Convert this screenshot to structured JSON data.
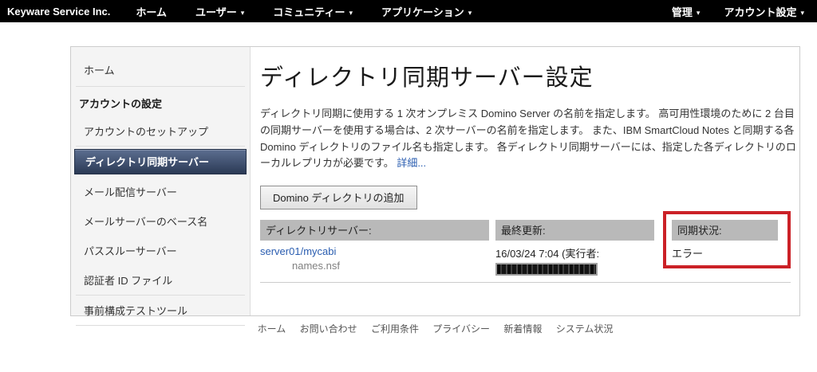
{
  "icons": {
    "caret": "▾"
  },
  "colors": {
    "topbar_bg": "#000000",
    "selected_gradient_top": "#5c6e90",
    "selected_gradient_bottom": "#2b3a55",
    "table_header_gray": "#b9b9b9",
    "link_blue": "#2a5db0",
    "highlight_red": "#cb2127"
  },
  "topbar": {
    "brand": "Keyware Service Inc.",
    "items": [
      {
        "label": "ホーム"
      },
      {
        "label": "ユーザー"
      },
      {
        "label": "コミュニティー"
      },
      {
        "label": "アプリケーション"
      }
    ],
    "right_items": [
      {
        "label": "管理"
      },
      {
        "label": "アカウント設定"
      }
    ]
  },
  "sidebar": {
    "home_label": "ホーム",
    "section_label": "アカウントの設定",
    "items": [
      {
        "label": "アカウントのセットアップ",
        "selected": false
      },
      {
        "label": "ディレクトリ同期サーバー",
        "selected": true
      },
      {
        "label": "メール配信サーバー",
        "selected": false
      },
      {
        "label": "メールサーバーのベース名",
        "selected": false
      },
      {
        "label": "パススルーサーバー",
        "selected": false
      },
      {
        "label": "認証者 ID ファイル",
        "selected": false
      },
      {
        "label": "事前構成テストツール",
        "selected": false
      }
    ]
  },
  "main": {
    "title": "ディレクトリ同期サーバー設定",
    "description": "ディレクトリ同期に使用する 1 次オンプレミス Domino Server の名前を指定します。 高可用性環境のために 2 台目の同期サーバーを使用する場合は、2 次サーバーの名前を指定します。 また、IBM SmartCloud Notes と同期する各 Domino ディレクトリのファイル名も指定します。 各ディレクトリ同期サーバーには、指定した各ディレクトリのローカルレプリカが必要です。 ",
    "details_link": "詳細...",
    "add_button": "Domino ディレクトリの追加",
    "table": {
      "headers": [
        "ディレクトリサーバー:",
        "最終更新:",
        "同期状況:"
      ],
      "row": {
        "server_link": "server01/mycabi",
        "directory_file": "names.nsf",
        "last_update": "16/03/24 7:04 (実行者:",
        "status": "エラー"
      }
    }
  },
  "footer": {
    "links": [
      "ホーム",
      "お問い合わせ",
      "ご利用条件",
      "プライバシー",
      "新着情報",
      "システム状況"
    ]
  }
}
